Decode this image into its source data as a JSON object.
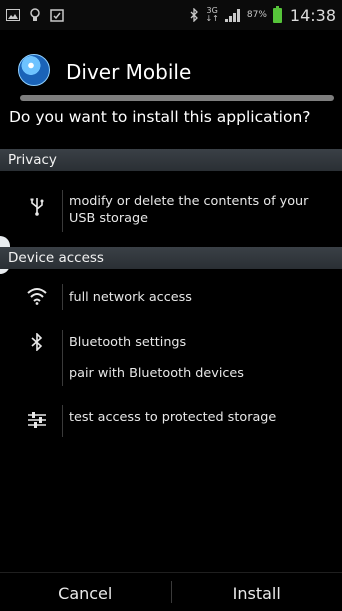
{
  "status_bar": {
    "icons": [
      "image-icon",
      "debug-icon",
      "clipboard-icon",
      "bluetooth-icon",
      "3g-icon",
      "signal-icon"
    ],
    "network": [
      "3G",
      "↓↑"
    ],
    "battery_percent": "87%",
    "time": "14:38"
  },
  "app": {
    "name": "Diver Mobile",
    "question": "Do you want to install this application?"
  },
  "sections": {
    "privacy": {
      "title": "Privacy"
    },
    "device": {
      "title": "Device access"
    }
  },
  "permissions": {
    "usb": {
      "line1": "modify or delete the contents of your",
      "line2": "USB storage"
    },
    "network": {
      "label": "full network access"
    },
    "bluetooth": {
      "line1": "Bluetooth settings",
      "line2": "pair with Bluetooth devices"
    },
    "storage": {
      "label": "test access to protected storage"
    }
  },
  "buttons": {
    "cancel": "Cancel",
    "install": "Install"
  },
  "colors": {
    "background": "#000000",
    "section_header": "#33393e",
    "battery": "#56c43a",
    "side_tab_arrow": "#3a8ed6"
  }
}
